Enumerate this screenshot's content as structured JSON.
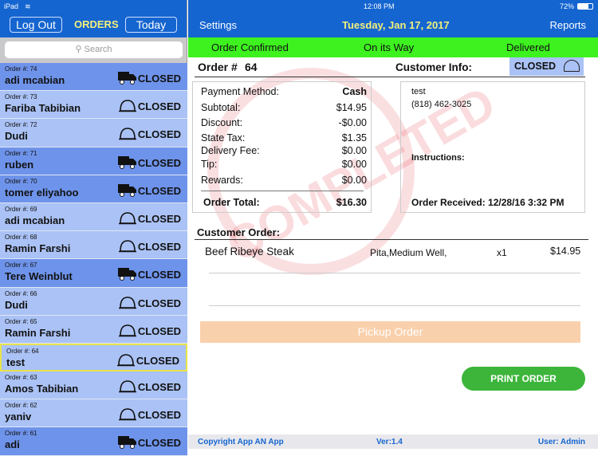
{
  "status": {
    "device": "iPad",
    "time": "12:08 PM",
    "battery": "72%"
  },
  "sidebar": {
    "logout": "Log Out",
    "title": "ORDERS",
    "today": "Today",
    "search_placeholder": "Search",
    "orders": [
      {
        "num": "Order #: 74",
        "name": "adi mcabian",
        "status": "CLOSED",
        "type": "delivery"
      },
      {
        "num": "Order #: 73",
        "name": "Fariba Tabibian",
        "status": "CLOSED",
        "type": "pickup"
      },
      {
        "num": "Order #: 72",
        "name": "Dudi",
        "status": "CLOSED",
        "type": "pickup"
      },
      {
        "num": "Order #: 71",
        "name": "ruben",
        "status": "CLOSED",
        "type": "delivery"
      },
      {
        "num": "Order #: 70",
        "name": "tomer eliyahoo",
        "status": "CLOSED",
        "type": "delivery"
      },
      {
        "num": "Order #: 69",
        "name": "adi mcabian",
        "status": "CLOSED",
        "type": "pickup"
      },
      {
        "num": "Order #: 68",
        "name": "Ramin Farshi",
        "status": "CLOSED",
        "type": "pickup"
      },
      {
        "num": "Order #: 67",
        "name": "Tere Weinblut",
        "status": "CLOSED",
        "type": "delivery"
      },
      {
        "num": "Order #: 66",
        "name": "Dudi",
        "status": "CLOSED",
        "type": "pickup"
      },
      {
        "num": "Order #: 65",
        "name": "Ramin Farshi",
        "status": "CLOSED",
        "type": "pickup"
      },
      {
        "num": "Order #: 64",
        "name": "test",
        "status": "CLOSED",
        "type": "pickup",
        "selected": true
      },
      {
        "num": "Order #: 63",
        "name": "Amos Tabibian",
        "status": "CLOSED",
        "type": "pickup"
      },
      {
        "num": "Order #: 62",
        "name": "yaniv",
        "status": "CLOSED",
        "type": "pickup"
      },
      {
        "num": "Order #: 61",
        "name": "adi",
        "status": "CLOSED",
        "type": "delivery"
      }
    ]
  },
  "header": {
    "settings": "Settings",
    "date": "Tuesday, Jan 17, 2017",
    "reports": "Reports"
  },
  "progress": {
    "step1": "Order Confirmed",
    "step2": "On its Way",
    "step3": "Delivered"
  },
  "order": {
    "label": "Order #",
    "number": "64",
    "customer_label": "Customer Info:",
    "status": "CLOSED",
    "payment_label": "Payment Method:",
    "payment": "Cash",
    "subtotal_label": "Subtotal:",
    "subtotal": "$14.95",
    "discount_label": "Discount:",
    "discount": "-$0.00",
    "tax_label": "State Tax:",
    "tax": "$1.35",
    "delivery_label": "Delivery Fee:",
    "delivery": "$0.00",
    "tip_label": "Tip:",
    "tip": "$0.00",
    "rewards_label": "Rewards:",
    "rewards": "$0.00",
    "total_label": "Order Total:",
    "total": "$16.30",
    "customer_name": "test",
    "customer_phone": "(818) 462-3025",
    "instructions_label": "Instructions:",
    "received": "Order Received: 12/28/16 3:32 PM",
    "stamp": "COMPLETED",
    "items_label": "Customer Order:",
    "items": [
      {
        "name": "Beef Ribeye Steak",
        "options": "Pita,Medium Well,",
        "qty": "x1",
        "price": "$14.95"
      }
    ],
    "pickup": "Pickup Order",
    "print": "PRINT ORDER"
  },
  "footer": {
    "copyright": "Copyright App AN App",
    "version": "Ver:1.4",
    "user": "User: Admin"
  },
  "colors": {
    "header": "#1565d0",
    "green": "#3df21f",
    "print": "#3cb53a"
  }
}
